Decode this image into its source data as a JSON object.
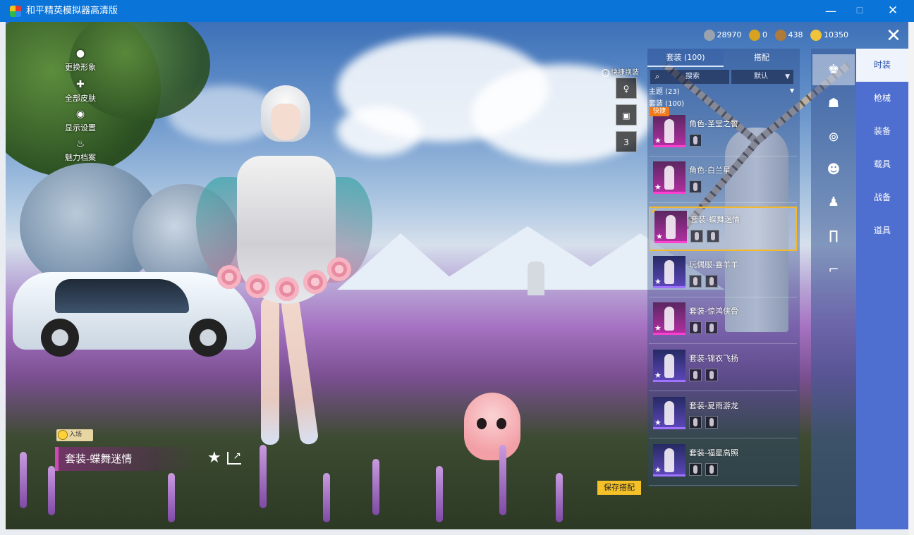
{
  "window": {
    "title": "和平精英模拟器高清版",
    "minimize": "—",
    "maximize": "☐",
    "close": "✕"
  },
  "left_menu": [
    {
      "label": "更换形象",
      "icon": "person-icon"
    },
    {
      "label": "全部皮肤",
      "icon": "puzzle-icon"
    },
    {
      "label": "显示设置",
      "icon": "eye-icon"
    },
    {
      "label": "魅力档案",
      "icon": "fire-icon"
    }
  ],
  "currencies": [
    {
      "value": "28970",
      "icon": "silver-coin-icon",
      "color": "#9aa3ad"
    },
    {
      "value": "0",
      "icon": "gold-token-icon",
      "color": "#d6a21f"
    },
    {
      "value": "438",
      "icon": "bronze-coin-icon",
      "color": "#b07a3a"
    },
    {
      "value": "10350",
      "icon": "coupon-icon",
      "color": "#f0c43a"
    }
  ],
  "close_label": "✕",
  "quick_swap": {
    "label": "快捷换装",
    "help": "?",
    "slot3_count": "3"
  },
  "tabs": {
    "outfits": "套装 (100)",
    "match": "搭配"
  },
  "search": {
    "placeholder": "搜索",
    "sort": "默认"
  },
  "filters": {
    "theme": "主题 (23)",
    "outfits": "套装 (100)"
  },
  "items": [
    {
      "name": "角色-圣堂之誓",
      "badge": "快捷",
      "style": "pink"
    },
    {
      "name": "角色-白兰星",
      "badge": "",
      "style": "pink"
    },
    {
      "name": "套装-蝶舞迷情",
      "badge": "✔",
      "style": "pink",
      "selected": true
    },
    {
      "name": "玩偶服-喜羊羊",
      "badge": "",
      "style": "blue"
    },
    {
      "name": "套装-惊鸿侠骨",
      "badge": "",
      "style": "pink"
    },
    {
      "name": "套装-锦衣飞扬",
      "badge": "",
      "style": "blue"
    },
    {
      "name": "套装-夏雨游龙",
      "badge": "",
      "style": "blue"
    },
    {
      "name": "套装-福星高照",
      "badge": "",
      "style": "blue"
    }
  ],
  "entry_badge": "入场",
  "current_outfit": "套装-蝶舞迷情",
  "save_button": "保存搭配",
  "categories": [
    "时装",
    "枪械",
    "装备",
    "载具",
    "战备",
    "道具"
  ],
  "side_icons": [
    "outfit-icon",
    "gun-skin-icon",
    "goggles-icon",
    "mask-icon",
    "figure-icon",
    "pants-icon",
    "socks-icon"
  ],
  "colors": {
    "titlebar": "#0a74d8",
    "accent_gold": "#f5c129",
    "selected_border": "#f1b92b",
    "category_bg": "#4e6fcf"
  }
}
